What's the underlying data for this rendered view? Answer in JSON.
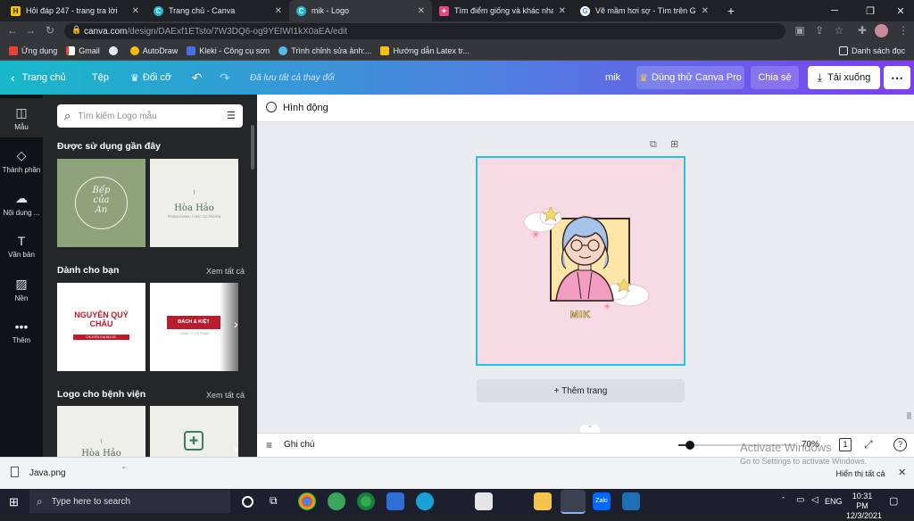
{
  "tabs": [
    {
      "title": "Hỏi đáp 247 - trang tra lời",
      "active": false
    },
    {
      "title": "Trang chủ - Canva",
      "active": false
    },
    {
      "title": "mik - Logo",
      "active": true
    },
    {
      "title": "Tìm điểm giống và khác nhau giữ",
      "active": false
    },
    {
      "title": "Vẽ mầm hơi sợ - Tìm trên Google",
      "active": false
    }
  ],
  "browser": {
    "url_host": "canva.com",
    "url_path": "/design/DAExf1ETsto/7W3DQ6-og9YEIWI1kX0aEA/edit",
    "new_tab": "+"
  },
  "bookmarks": [
    "Ứng dụng",
    "Gmail",
    "",
    "AutoDraw",
    "Kleki - Công cụ sơn",
    "Trình chỉnh sửa ảnh:...",
    "Hướng dẫn Latex tr..."
  ],
  "bookmarks_right": "Danh sách đọc",
  "canva": {
    "home": "Trang chủ",
    "file": "Tệp",
    "resize": "Đổi cỡ",
    "saved": "Đã lưu tất cả thay đổi",
    "design_name": "mik",
    "pro": "Dùng thử Canva Pro",
    "share": "Chia sẻ",
    "download": "Tải xuống"
  },
  "left_nav": [
    {
      "label": "Mẫu",
      "icon": "template-icon"
    },
    {
      "label": "Thành phần",
      "icon": "elements-icon"
    },
    {
      "label": "Nội dung ...",
      "icon": "upload-icon"
    },
    {
      "label": "Văn bản",
      "icon": "text-icon"
    },
    {
      "label": "Nền",
      "icon": "background-icon"
    },
    {
      "label": "Thêm",
      "icon": "more-icon"
    }
  ],
  "panel": {
    "search_placeholder": "Tìm kiếm Logo mẫu",
    "recent": "Được sử dụng gần đây",
    "for_you": "Dành cho bạn",
    "hospital": "Logo cho bệnh viện",
    "see_all": "Xem tất cả",
    "cards": {
      "c1": {
        "l1": "Bếp",
        "l2": "của",
        "l3": "An"
      },
      "c2": {
        "main": "Hòa Hảo",
        "sub": "PHÒNG KHÁM • Y HỌC CỔ TRUYỀN"
      },
      "c3": {
        "main1": "NGUYỄN QUÝ",
        "main2": "CHÂU",
        "sub": "CHUYÊN GIA ĐỊA ỐC"
      },
      "c4": {
        "main": "BÁCH & KIỆT",
        "sub": "CÔNG TY CỔ PHẦN"
      },
      "c5": {
        "main": "Hòa Hảo"
      }
    }
  },
  "editor": {
    "animate": "Hình động",
    "add_page": "+ Thêm trang",
    "notes": "Ghi chú",
    "zoom": "70%",
    "page_count": "1",
    "logo_text": "MIK"
  },
  "watermark": {
    "l1": "Activate Windows",
    "l2": "Go to Settings to activate Windows."
  },
  "download": {
    "file": "Java.png",
    "show_all": "Hiển thị tất cả"
  },
  "taskbar": {
    "search": "Type here to search",
    "time": "10:31 PM",
    "date": "12/3/2021",
    "lang": "ENG"
  },
  "colors": {
    "header_start": "#17b8c9",
    "header_end": "#7d3ff0",
    "canvas_bg": "#f6dbe5",
    "selection": "#26c2e3"
  }
}
